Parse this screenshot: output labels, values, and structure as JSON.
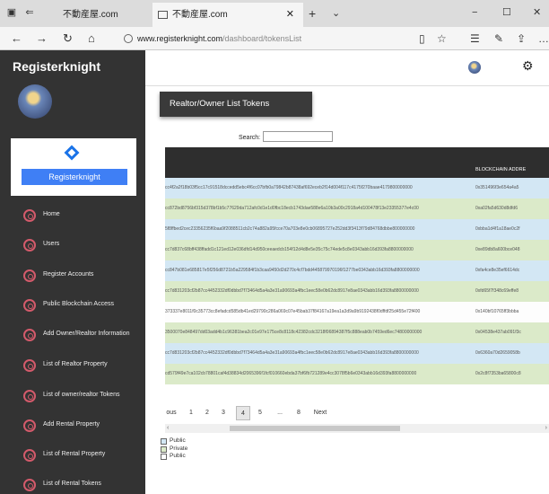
{
  "browser": {
    "tab_inactive": "不動産屋.com",
    "tab_active": "不動産屋.com",
    "url_host": "www.registerknight.com",
    "url_path": "/dashboard/tokensList"
  },
  "sidebar": {
    "brand": "Registerknight",
    "card_button": "Registerknight",
    "items": [
      {
        "label": "Home"
      },
      {
        "label": "Users"
      },
      {
        "label": "Register Accounts"
      },
      {
        "label": "Public Blockchain Access"
      },
      {
        "label": "Add Owner/Realtor Information"
      },
      {
        "label": "List of Realtor Property"
      },
      {
        "label": "List of owner/realtor Tokens"
      },
      {
        "label": "Add Rental Property"
      },
      {
        "label": "List of Rental Property"
      },
      {
        "label": "List of Rental Tokens"
      }
    ]
  },
  "main": {
    "card_title": "Realtor/Owner List Tokens",
    "search_label": "Search:",
    "column_header": "BLOCKCHAIN ADDRE",
    "rows": [
      {
        "c1": "cc4f2a2f18b03f5cc17c91518dccedd5ebc4f6cc07bfb0a79842b87438af692eceb2f14d004f117c4175f270baae4179800000000",
        "c2": "0x351496f3e654a4a5",
        "color": "blue"
      },
      {
        "c1": "cc872bd8756bf315d378bf1b5c77629da712afc0d1e1d0fbc18ecb1743dae588e6a10b3a00c2918a4d100478f13e23355377e4c00",
        "c2": "0xa02fa5d630d8dfd6",
        "color": "green"
      },
      {
        "c1": "5f8ffbed2cec23356235f6baa9f2088511cb2c74a882a95fcce70a703e8e0cb06895727e252dd3f3413f79d84768dbbe800000000",
        "c2": "0xbba1d4f1a18ae0c2f",
        "color": "blue"
      },
      {
        "c1": "cc7d837c68bff438ffadd1c121ed12e036dfd14d950ceeaedcb154f12d4d8e5e35c75c74ede5c8e0343abb16d393fa8800000000",
        "c2": "0xe89db8a600bce048",
        "color": "green"
      },
      {
        "c1": "cc847b081e685817e5f256d8721b5a229584f1b3caa9450d2d270c4cf7bdd445879970196f1277be0343abb16d393fa8800000000",
        "c2": "0xfa4ce8e35ef6614dc",
        "color": "blue"
      },
      {
        "c1": "cc7d831203cf2b87cc4452332df0dbbd7f73464d5a4a3e31a90693a4fbc1eec58e0b62dc8917e8ae0343abb16d393fa8800000000",
        "c2": "0xfd65f7f348c69effe8",
        "color": "green"
      },
      {
        "c1": "373337e8011f0c35773cc8efadcd585db41ed29790c286a069c07e45bab37f84167a19ea1a3d9a9b9192438f0dffdf25d455e72f400",
        "c2": "0x140bf10765ff3bbba",
        "color": "white"
      },
      {
        "c1": "3500070e848497dd03add4b1c96381bea2c01e97e175ce8c8118c42382cdc3218f06894387f5c888eab0b7459ed6ec74800000000",
        "c2": "0x04538e437ab091f3c",
        "color": "green"
      },
      {
        "c1": "cc7d831203cf2b87cc4452332df0dbbd7f73464d5a4a3e31a90693a4fbc1eec58e0b62dc8917e8ae0343abb16d393fa8800000000",
        "c2": "0x6360a70d2659058b",
        "color": "blue"
      },
      {
        "c1": "cd579f49e7ca102cb78801caf4d38834d2065396f1fcf010660ebda37bf6fb721289e4cc3078f5b6e0343abb16d393fa8800000000",
        "c2": "0x2c8f7353ba65800c8",
        "color": "green"
      }
    ],
    "pager": [
      "ous",
      "1",
      "2",
      "3",
      "4",
      "5",
      "...",
      "8",
      "Next"
    ],
    "legend": [
      "Public",
      "Private",
      "Public"
    ]
  }
}
